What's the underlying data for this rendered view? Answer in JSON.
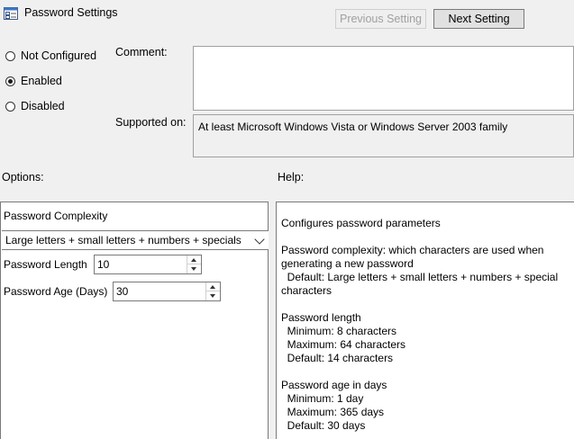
{
  "window": {
    "title": "Password Settings",
    "icon": "policy-settings-icon"
  },
  "nav": {
    "previous_label": "Previous Setting",
    "next_label": "Next Setting"
  },
  "state": {
    "options": [
      "Not Configured",
      "Enabled",
      "Disabled"
    ],
    "selected": "Enabled"
  },
  "comment": {
    "label": "Comment:",
    "value": ""
  },
  "supported": {
    "label": "Supported on:",
    "value": "At least Microsoft Windows Vista or Windows Server 2003 family"
  },
  "sections": {
    "options_label": "Options:",
    "help_label": "Help:"
  },
  "options": {
    "complexity_label": "Password Complexity",
    "complexity_value": "Large letters + small letters + numbers + specials",
    "length_label": "Password Length",
    "length_value": "10",
    "age_label": "Password Age (Days)",
    "age_value": "30"
  },
  "help": {
    "lines": [
      "Configures password parameters",
      "",
      "Password complexity: which characters are used when",
      "generating a new password",
      "  Default: Large letters + small letters + numbers + special",
      "characters",
      "",
      "Password length",
      "  Minimum: 8 characters",
      "  Maximum: 64 characters",
      "  Default: 14 characters",
      "",
      "Password age in days",
      "  Minimum: 1 day",
      "  Maximum: 365 days",
      "  Default: 30 days"
    ]
  }
}
